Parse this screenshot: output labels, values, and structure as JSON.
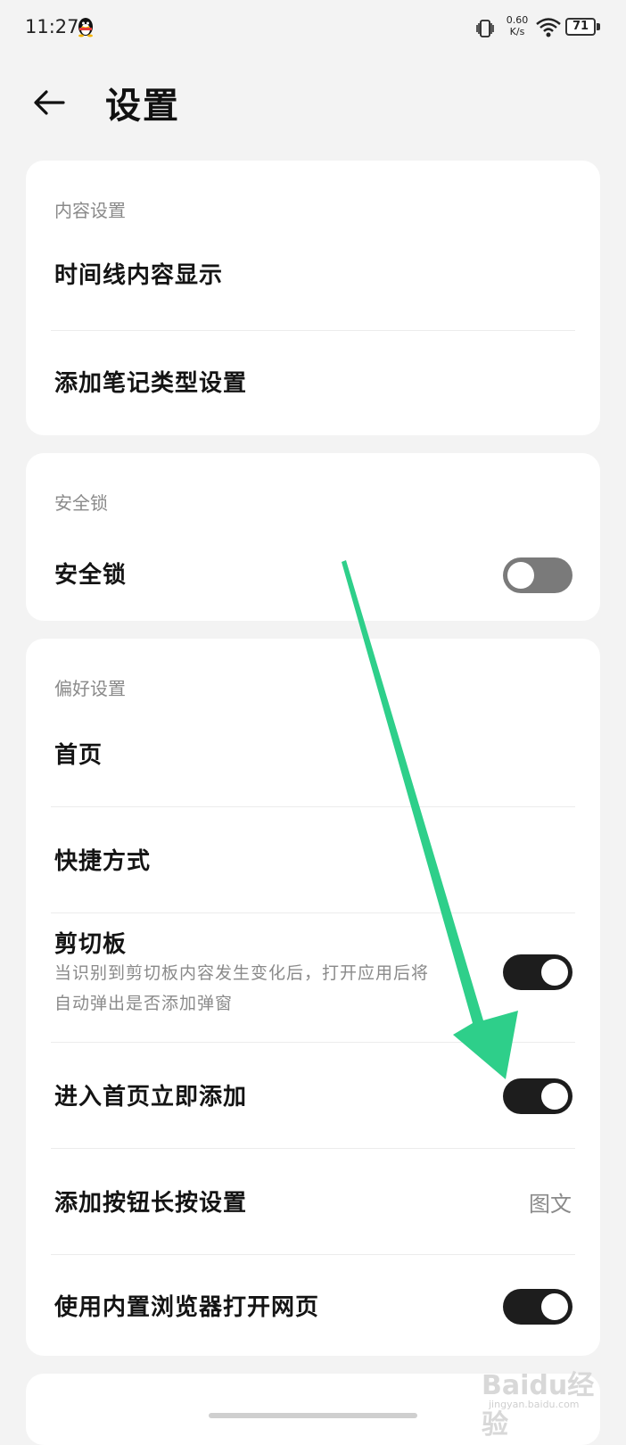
{
  "status_bar": {
    "time": "11:27",
    "net_speed_value": "0.60",
    "net_speed_unit": "K/s",
    "battery": "71",
    "icons": [
      "qq-penguin-icon",
      "vibrate-icon",
      "wifi-icon",
      "battery-icon"
    ]
  },
  "header": {
    "back_icon": "arrow-left-icon",
    "title": "设置"
  },
  "sections": {
    "content": {
      "label": "内容设置",
      "items": [
        {
          "label": "时间线内容显示"
        },
        {
          "label": "添加笔记类型设置"
        }
      ]
    },
    "security": {
      "label": "安全锁",
      "items": [
        {
          "label": "安全锁",
          "toggle": "off"
        }
      ]
    },
    "preferences": {
      "label": "偏好设置",
      "items": [
        {
          "label": "首页"
        },
        {
          "label": "快捷方式"
        },
        {
          "label": "剪切板",
          "description": "当识别到剪切板内容发生变化后，打开应用后将自动弹出是否添加弹窗",
          "toggle": "on"
        },
        {
          "label": "进入首页立即添加",
          "toggle": "on"
        },
        {
          "label": "添加按钮长按设置",
          "value": "图文"
        },
        {
          "label": "使用内置浏览器打开网页",
          "toggle": "on"
        }
      ]
    }
  },
  "annotation": {
    "arrow_color": "#2ecf8a"
  },
  "watermark": {
    "text": "Baidu经验",
    "subtext": "jingyan.baidu.com"
  },
  "colors": {
    "background": "#f3f3f3",
    "card": "#ffffff",
    "toggle_on": "#1d1d1d",
    "toggle_off": "#7a7a7a"
  }
}
